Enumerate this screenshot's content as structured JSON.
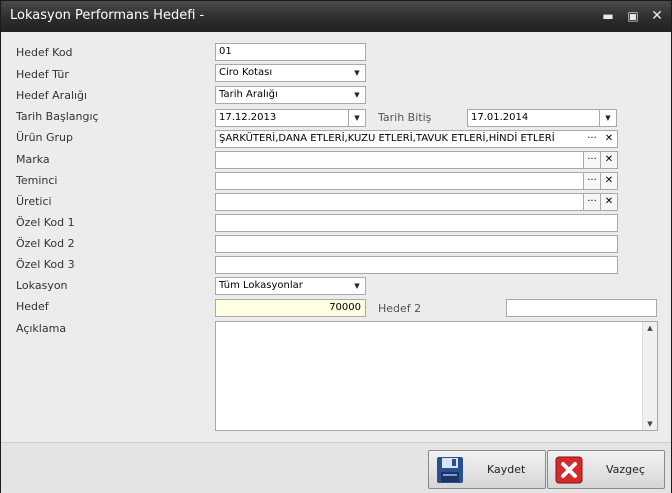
{
  "window": {
    "title": "Lokasyon Performans Hedefi -"
  },
  "fields": {
    "hedef_kod": {
      "label": "Hedef Kod",
      "value": "01"
    },
    "hedef_tur": {
      "label": "Hedef Tür",
      "value": "Ciro Kotası"
    },
    "hedef_araligi": {
      "label": "Hedef Aralığı",
      "value": "Tarih Aralığı"
    },
    "tarih_baslangic": {
      "label": "Tarih Başlangıç",
      "value": "17.12.2013"
    },
    "tarih_bitis": {
      "label": "Tarih Bitiş",
      "value": "17.01.2014"
    },
    "urun_grup": {
      "label": "Ürün Grup",
      "value": "ŞARKÜTERİ,DANA ETLERİ,KUZU ETLERİ,TAVUK ETLERİ,HİNDİ ETLERİ"
    },
    "marka": {
      "label": "Marka",
      "value": ""
    },
    "teminci": {
      "label": "Teminci",
      "value": ""
    },
    "uretici": {
      "label": "Üretici",
      "value": ""
    },
    "ozel_kod_1": {
      "label": "Özel Kod 1",
      "value": ""
    },
    "ozel_kod_2": {
      "label": "Özel Kod 2",
      "value": ""
    },
    "ozel_kod_3": {
      "label": "Özel Kod 3",
      "value": ""
    },
    "lokasyon": {
      "label": "Lokasyon",
      "value": "Tüm Lokasyonlar"
    },
    "hedef": {
      "label": "Hedef",
      "value": "70000"
    },
    "hedef_2": {
      "label": "Hedef 2",
      "value": ""
    },
    "aciklama": {
      "label": "Açıklama",
      "value": ""
    }
  },
  "buttons": {
    "save": "Kaydet",
    "cancel": "Vazgeç",
    "ellipsis": "···",
    "clear": "✕"
  },
  "icons": {
    "minimize": "minimize-icon",
    "maximize": "maximize-icon",
    "close": "close-icon",
    "dropdown": "chevron-down-icon",
    "save": "floppy-disk-icon",
    "cancel": "cancel-x-icon"
  },
  "colors": {
    "highlight_bg": "#ffffe1",
    "title_bg": "#2b2b2b"
  }
}
